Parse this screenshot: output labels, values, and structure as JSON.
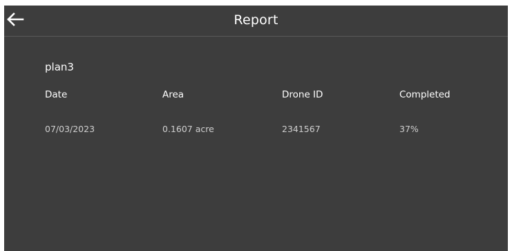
{
  "header": {
    "title": "Report",
    "back_icon": "arrow-left-icon"
  },
  "report": {
    "plan_name": "plan3",
    "columns": [
      "Date",
      "Area",
      "Drone ID",
      "Completed"
    ],
    "rows": [
      [
        "07/03/2023",
        "0.1607 acre",
        "2341567",
        "37%"
      ]
    ]
  },
  "colors": {
    "background": "#3d3d3d",
    "text_primary": "#ffffff",
    "text_secondary": "#cfcfcf",
    "divider": "#5a5a5a"
  }
}
